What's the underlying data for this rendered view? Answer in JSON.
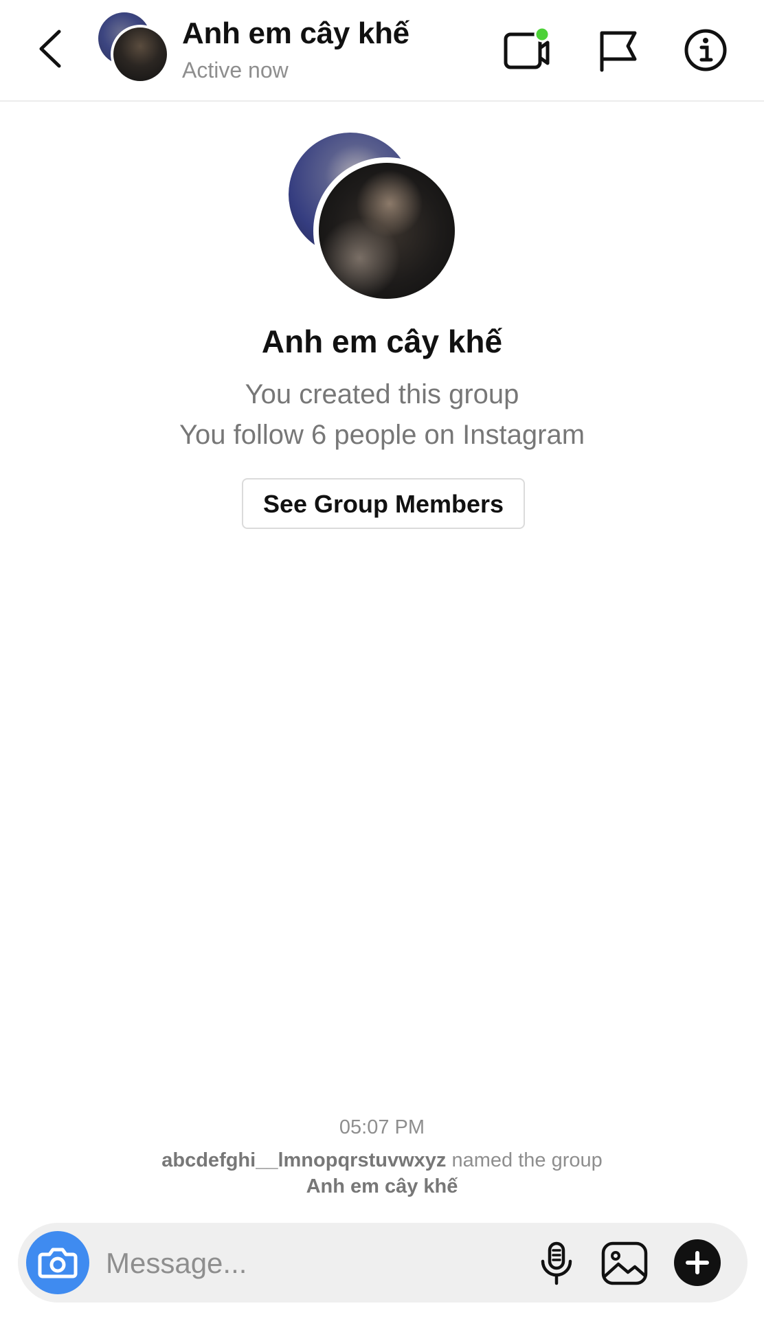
{
  "header": {
    "title": "Anh em cây khế",
    "status": "Active now",
    "icons": {
      "back": "chevron-left-icon",
      "video": "video-call-icon",
      "flag": "flag-icon",
      "info": "info-icon"
    },
    "colors": {
      "active_dot": "#4cd137"
    }
  },
  "group": {
    "name": "Anh em cây khế",
    "created_text": "You created this group",
    "follow_text": "You follow 6 people on Instagram",
    "see_members_label": "See Group Members"
  },
  "event": {
    "time": "05:07 PM",
    "username": "abcdefghi__lmnopqrstuvwxyz",
    "action_text": "named the group",
    "new_name": "Anh em cây khế"
  },
  "composer": {
    "placeholder": "Message...",
    "value": "",
    "icons": {
      "camera": "camera-icon",
      "mic": "microphone-icon",
      "gallery": "gallery-icon",
      "plus": "plus-icon"
    },
    "colors": {
      "camera_bg": "#3f8bf0"
    }
  }
}
